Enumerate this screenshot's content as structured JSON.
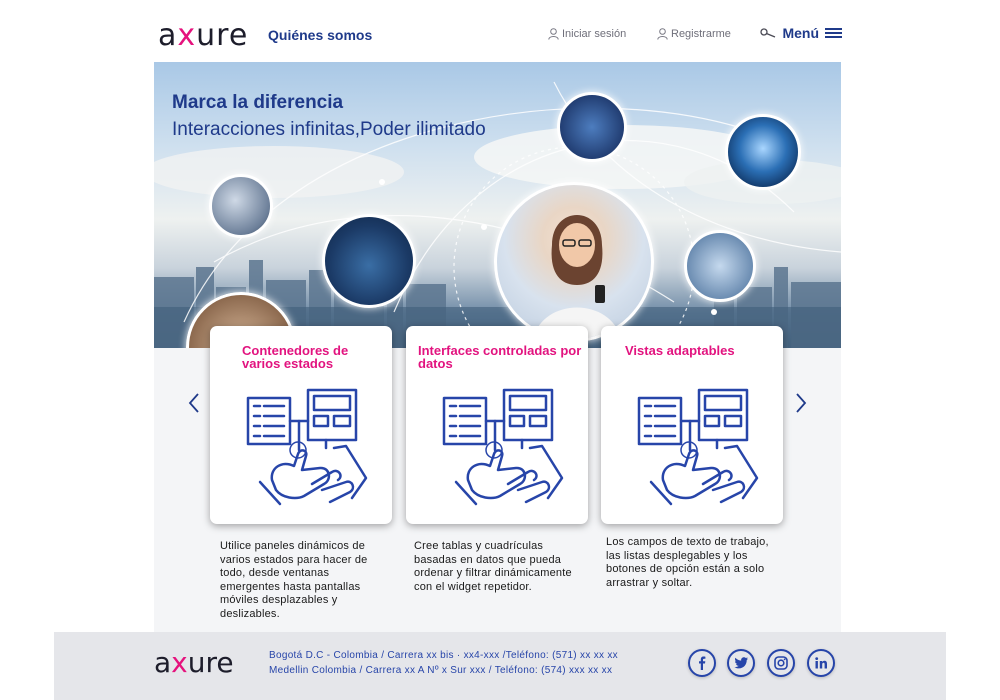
{
  "header": {
    "logo_left": "a",
    "logo_x": "x",
    "logo_right": "ure",
    "nav_about": "Quiénes somos",
    "login": "Iniciar sesión",
    "register": "Registrarme",
    "menu": "Menú"
  },
  "hero": {
    "title": "Marca la diferencia",
    "subtitle": "Interacciones infinitas,Poder ilimitado"
  },
  "cards": [
    {
      "title": "Contenedores de varios estados",
      "description": "Utilice paneles dinámicos de varios estados para hacer de todo, desde ventanas emergentes hasta pantallas móviles desplazables y deslizables."
    },
    {
      "title": "Interfaces controladas por datos",
      "description": "Cree tablas y cuadrículas basadas en datos que pueda ordenar y filtrar dinámicamente con el widget repetidor."
    },
    {
      "title": "Vistas adaptables",
      "description": "Los campos de texto de trabajo, las listas desplegables y los botones de opción están a solo arrastrar y soltar."
    }
  ],
  "footer": {
    "address_1": "Bogotá D.C - Colombia / Carrera xx bis · xx4-xxx /Teléfono: (571) xx xx xx",
    "address_2": "Medellin Colombia / Carrera xx A Nº x  Sur xxx / Teléfono: (574) xxx xx xx",
    "social": [
      "facebook-icon",
      "twitter-icon",
      "instagram-icon",
      "linkedin-icon"
    ]
  },
  "colors": {
    "brand_blue": "#1f3a8a",
    "accent_pink": "#e2137f",
    "link_blue": "#2745a9"
  }
}
